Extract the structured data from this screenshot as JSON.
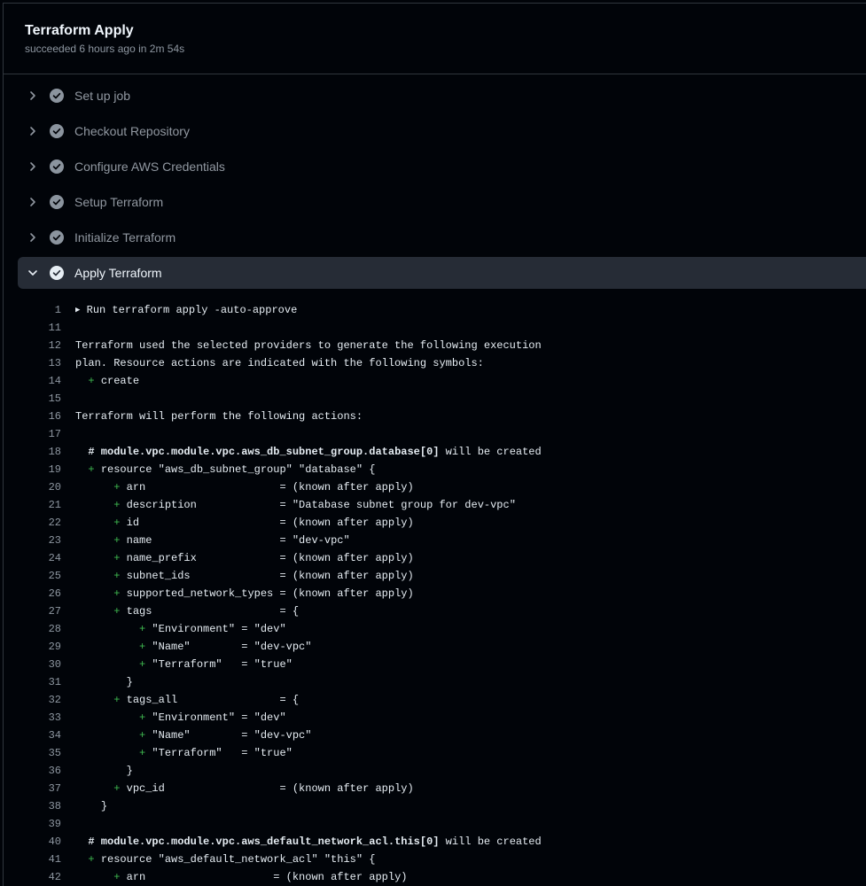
{
  "job": {
    "title": "Terraform Apply",
    "subtitle": "succeeded 6 hours ago in 2m 54s"
  },
  "colors": {
    "success_icon": "#8b949e",
    "expanded_row_bg": "#262c36",
    "diff_plus": "#3fb950"
  },
  "steps": [
    {
      "label": "Set up job",
      "status": "success",
      "expanded": false,
      "icon": "check-circle-icon"
    },
    {
      "label": "Checkout Repository",
      "status": "success",
      "expanded": false,
      "icon": "check-circle-icon"
    },
    {
      "label": "Configure AWS Credentials",
      "status": "success",
      "expanded": false,
      "icon": "check-circle-icon"
    },
    {
      "label": "Setup Terraform",
      "status": "success",
      "expanded": false,
      "icon": "check-circle-icon"
    },
    {
      "label": "Initialize Terraform",
      "status": "success",
      "expanded": false,
      "icon": "check-circle-icon"
    },
    {
      "label": "Apply Terraform",
      "status": "success",
      "expanded": true,
      "icon": "check-circle-icon"
    }
  ],
  "log": [
    {
      "n": "1",
      "group": true,
      "text": "Run terraform apply -auto-approve"
    },
    {
      "n": "11",
      "text": ""
    },
    {
      "n": "12",
      "text": "Terraform used the selected providers to generate the following execution"
    },
    {
      "n": "13",
      "text": "plan. Resource actions are indicated with the following symbols:"
    },
    {
      "n": "14",
      "indent": "  ",
      "plus": true,
      "text": "create"
    },
    {
      "n": "15",
      "text": ""
    },
    {
      "n": "16",
      "text": "Terraform will perform the following actions:"
    },
    {
      "n": "17",
      "text": ""
    },
    {
      "n": "18",
      "indent": "  ",
      "bold": "# module.vpc.module.vpc.aws_db_subnet_group.database[0]",
      "text": " will be created"
    },
    {
      "n": "19",
      "indent": "  ",
      "plus": true,
      "text": "resource \"aws_db_subnet_group\" \"database\" {"
    },
    {
      "n": "20",
      "indent": "      ",
      "plus": true,
      "text": "arn                     = (known after apply)"
    },
    {
      "n": "21",
      "indent": "      ",
      "plus": true,
      "text": "description             = \"Database subnet group for dev-vpc\""
    },
    {
      "n": "22",
      "indent": "      ",
      "plus": true,
      "text": "id                      = (known after apply)"
    },
    {
      "n": "23",
      "indent": "      ",
      "plus": true,
      "text": "name                    = \"dev-vpc\""
    },
    {
      "n": "24",
      "indent": "      ",
      "plus": true,
      "text": "name_prefix             = (known after apply)"
    },
    {
      "n": "25",
      "indent": "      ",
      "plus": true,
      "text": "subnet_ids              = (known after apply)"
    },
    {
      "n": "26",
      "indent": "      ",
      "plus": true,
      "text": "supported_network_types = (known after apply)"
    },
    {
      "n": "27",
      "indent": "      ",
      "plus": true,
      "text": "tags                    = {"
    },
    {
      "n": "28",
      "indent": "          ",
      "plus": true,
      "text": "\"Environment\" = \"dev\""
    },
    {
      "n": "29",
      "indent": "          ",
      "plus": true,
      "text": "\"Name\"        = \"dev-vpc\""
    },
    {
      "n": "30",
      "indent": "          ",
      "plus": true,
      "text": "\"Terraform\"   = \"true\""
    },
    {
      "n": "31",
      "indent": "        ",
      "text": "}"
    },
    {
      "n": "32",
      "indent": "      ",
      "plus": true,
      "text": "tags_all                = {"
    },
    {
      "n": "33",
      "indent": "          ",
      "plus": true,
      "text": "\"Environment\" = \"dev\""
    },
    {
      "n": "34",
      "indent": "          ",
      "plus": true,
      "text": "\"Name\"        = \"dev-vpc\""
    },
    {
      "n": "35",
      "indent": "          ",
      "plus": true,
      "text": "\"Terraform\"   = \"true\""
    },
    {
      "n": "36",
      "indent": "        ",
      "text": "}"
    },
    {
      "n": "37",
      "indent": "      ",
      "plus": true,
      "text": "vpc_id                  = (known after apply)"
    },
    {
      "n": "38",
      "indent": "    ",
      "text": "}"
    },
    {
      "n": "39",
      "text": ""
    },
    {
      "n": "40",
      "indent": "  ",
      "bold": "# module.vpc.module.vpc.aws_default_network_acl.this[0]",
      "text": " will be created"
    },
    {
      "n": "41",
      "indent": "  ",
      "plus": true,
      "text": "resource \"aws_default_network_acl\" \"this\" {"
    },
    {
      "n": "42",
      "indent": "      ",
      "plus": true,
      "text": "arn                    = (known after apply)"
    }
  ]
}
